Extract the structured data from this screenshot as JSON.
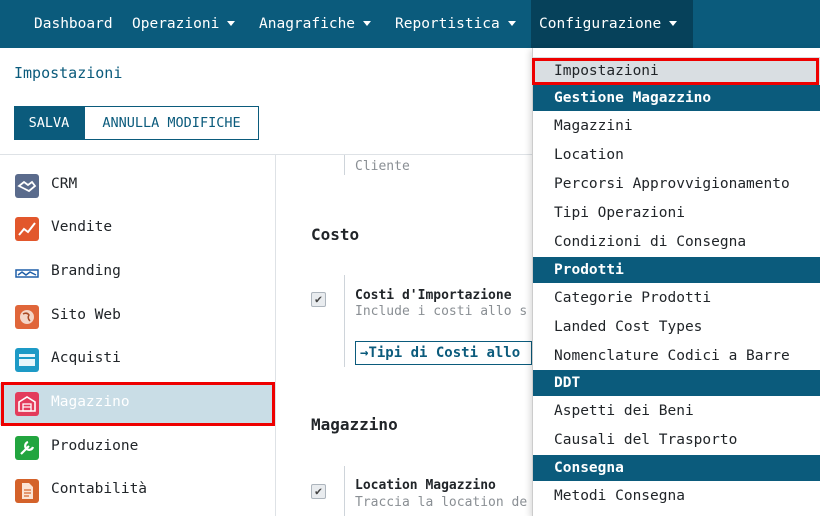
{
  "topnav": {
    "items": [
      {
        "label": "Dashboard",
        "dropdown": false
      },
      {
        "label": "Operazioni",
        "dropdown": true
      },
      {
        "label": "Anagrafiche",
        "dropdown": true
      },
      {
        "label": "Reportistica",
        "dropdown": true
      },
      {
        "label": "Configurazione",
        "dropdown": true,
        "active": true
      }
    ]
  },
  "page": {
    "title": "Impostazioni",
    "save_label": "SALVA",
    "cancel_label": "ANNULLA MODIFICHE"
  },
  "sidebar": {
    "items": [
      {
        "label": "CRM",
        "icon": "handshake-icon",
        "color": "#5a6b8c"
      },
      {
        "label": "Vendite",
        "icon": "chart-line-icon",
        "color": "#e2572c"
      },
      {
        "label": "Branding",
        "icon": "brand-logo-icon",
        "color": "#1f5fa8"
      },
      {
        "label": "Sito Web",
        "icon": "globe-icon",
        "color": "#e0663a"
      },
      {
        "label": "Acquisti",
        "icon": "credit-card-icon",
        "color": "#1d9ac6"
      },
      {
        "label": "Magazzino",
        "icon": "warehouse-icon",
        "color": "#e33c5c",
        "selected": true
      },
      {
        "label": "Produzione",
        "icon": "wrench-icon",
        "color": "#22a53f"
      },
      {
        "label": "Contabilità",
        "icon": "document-icon",
        "color": "#d4622a"
      }
    ]
  },
  "content": {
    "top_desc": "Cliente",
    "sections": [
      {
        "title": "Costo",
        "setting": {
          "title": "Costi d'Importazione",
          "desc": "Include i costi allo s",
          "checked": true,
          "link": "Tipi di Costi allo"
        }
      },
      {
        "title": "Magazzino",
        "setting": {
          "title": "Location Magazzino",
          "desc": "Traccia la location de",
          "checked": true
        }
      }
    ]
  },
  "dropdown": {
    "entries": [
      {
        "type": "item",
        "label": "Impostazioni",
        "current": true
      },
      {
        "type": "header",
        "label": "Gestione Magazzino"
      },
      {
        "type": "item",
        "label": "Magazzini"
      },
      {
        "type": "item",
        "label": "Location"
      },
      {
        "type": "item",
        "label": "Percorsi Approvvigionamento"
      },
      {
        "type": "item",
        "label": "Tipi Operazioni"
      },
      {
        "type": "item",
        "label": "Condizioni di Consegna"
      },
      {
        "type": "header",
        "label": "Prodotti"
      },
      {
        "type": "item",
        "label": "Categorie Prodotti"
      },
      {
        "type": "item",
        "label": "Landed Cost Types"
      },
      {
        "type": "item",
        "label": "Nomenclature Codici a Barre"
      },
      {
        "type": "header",
        "label": "DDT"
      },
      {
        "type": "item",
        "label": "Aspetti dei Beni"
      },
      {
        "type": "item",
        "label": "Causali del Trasporto"
      },
      {
        "type": "header",
        "label": "Consegna"
      },
      {
        "type": "item",
        "label": "Metodi Consegna"
      }
    ]
  },
  "colors": {
    "brand": "#0b5b7c",
    "highlight": "#e00000"
  }
}
